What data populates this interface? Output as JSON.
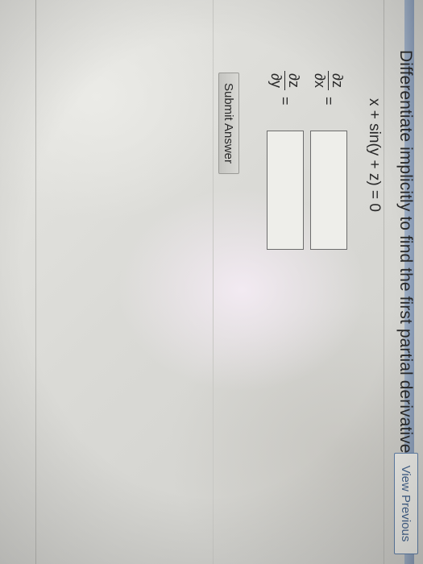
{
  "question": {
    "prompt": "Differentiate implicitly to find the first partial derivatives of z.",
    "equation": "x + sin(y + z) = 0"
  },
  "derivatives": [
    {
      "numerator": "∂z",
      "denominator": "∂x",
      "equals": "=",
      "value": ""
    },
    {
      "numerator": "∂z",
      "denominator": "∂y",
      "equals": "=",
      "value": ""
    }
  ],
  "buttons": {
    "submit": "Submit Answer",
    "view_previous": "View Previous"
  },
  "colors": {
    "link_accent": "#44638c",
    "text": "#2a2a2a"
  }
}
